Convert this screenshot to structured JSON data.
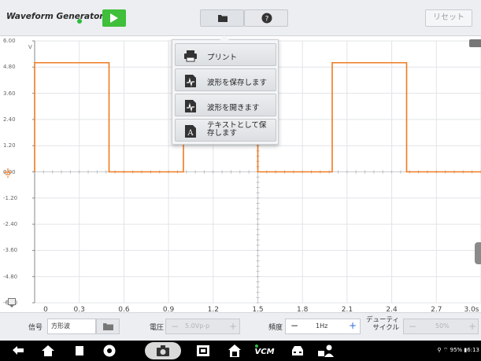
{
  "header": {
    "title": "Waveform Generator",
    "reset_label": "リセット"
  },
  "file_menu": {
    "items": [
      {
        "label": "プリント",
        "icon": "printer-icon"
      },
      {
        "label": "波形を保存します",
        "icon": "save-waveform-icon"
      },
      {
        "label": "波形を開きます",
        "icon": "open-waveform-icon"
      },
      {
        "label": "テキストとして保存します",
        "line1": "テキストとして保",
        "line2": "存します",
        "icon": "save-text-icon"
      }
    ]
  },
  "chart_data": {
    "type": "line",
    "y_ticks": [
      "6.00",
      "4.80",
      "3.60",
      "2.40",
      "1.20",
      "0.00",
      "-1.20",
      "-2.40",
      "-3.60",
      "-4.80",
      "-6.00"
    ],
    "x_ticks": [
      "0",
      "0.3",
      "0.6",
      "0.9",
      "1.2",
      "1.5",
      "1.8",
      "2.1",
      "2.4",
      "2.7",
      "3.0s"
    ],
    "ylim": [
      -6,
      6
    ],
    "xlim": [
      0,
      3.0
    ],
    "grid": true,
    "series": [
      {
        "color": "#f07a20",
        "x": [
          0,
          0,
          0.5,
          0.5,
          1.0,
          1.0,
          1.5,
          1.5,
          2.0,
          2.0,
          2.5,
          2.5,
          3.0
        ],
        "y": [
          0,
          5,
          5,
          0,
          0,
          5,
          5,
          0,
          0,
          5,
          5,
          0,
          0
        ]
      }
    ],
    "y_unit": "V"
  },
  "controls": {
    "signal_label": "信号",
    "signal_value": "方形波",
    "voltage_label": "電圧",
    "voltage_value": "5.0Vp-p",
    "freq_label": "頻度",
    "freq_value": "1Hz",
    "duty_label_1": "デューティ",
    "duty_label_2": "サイクル",
    "duty_value": "50%",
    "minus": "−",
    "plus": "+"
  },
  "status": {
    "battery": "95%",
    "time": "6:13"
  },
  "colors": {
    "waveform": "#f07a20",
    "play": "#3fbf3a",
    "accent": "#2a6fd6"
  }
}
